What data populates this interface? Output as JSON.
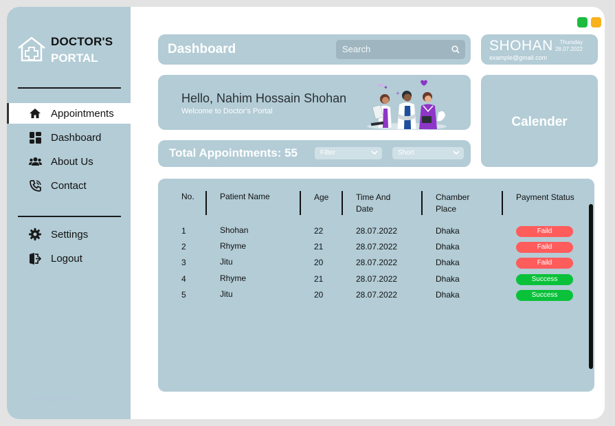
{
  "sidebar": {
    "logo_line1": "DOCTOR'S",
    "logo_line2": "PORTAL",
    "items": [
      {
        "label": "Appointments",
        "icon": "home-icon",
        "active": true
      },
      {
        "label": "Dashboard",
        "icon": "grid-icon"
      },
      {
        "label": "About Us",
        "icon": "users-icon"
      },
      {
        "label": "Contact",
        "icon": "phone-icon"
      }
    ],
    "bottom_items": [
      {
        "label": "Settings",
        "icon": "gear-icon"
      },
      {
        "label": "Logout",
        "icon": "logout-icon"
      }
    ]
  },
  "header": {
    "title": "Dashboard",
    "search_label": "Search"
  },
  "profile": {
    "name": "SHOHAN",
    "day": "Thursday",
    "date": "28.07.2022",
    "email": "example@gmail.com"
  },
  "welcome": {
    "greeting": "Hello, Nahim Hossain Shohan",
    "subtitle": "Welcome to Doctor's Portal"
  },
  "calendar": {
    "label": "Calender"
  },
  "appointments": {
    "total_label": "Total Appointments: 55",
    "filter_label": "Filter",
    "short_label": "Short"
  },
  "table": {
    "headers": {
      "no": "No.",
      "patient": "Patient Name",
      "age": "Age",
      "time_line1": "Time And",
      "time_line2": "Date",
      "chamber_line1": "Chamber",
      "chamber_line2": "Place",
      "payment": "Payment Status"
    },
    "rows": [
      {
        "no": "1",
        "patient": "Shohan",
        "age": "22",
        "date": "28.07.2022",
        "place": "Dhaka",
        "status": "Faild"
      },
      {
        "no": "2",
        "patient": "Rhyme",
        "age": "21",
        "date": "28.07.2022",
        "place": "Dhaka",
        "status": "Faild"
      },
      {
        "no": "3",
        "patient": "Jitu",
        "age": "20",
        "date": "28.07.2022",
        "place": "Dhaka",
        "status": "Faild"
      },
      {
        "no": "4",
        "patient": "Rhyme",
        "age": "21",
        "date": "28.07.2022",
        "place": "Dhaka",
        "status": "Success"
      },
      {
        "no": "5",
        "patient": "Jitu",
        "age": "20",
        "date": "28.07.2022",
        "place": "Dhaka",
        "status": "Success"
      }
    ]
  },
  "colors": {
    "panel": "#b3ccd6",
    "failed": "#ff5c5c",
    "success": "#0ac13a",
    "window_green": "#1dbb3e",
    "window_yellow": "#f8b21d"
  }
}
